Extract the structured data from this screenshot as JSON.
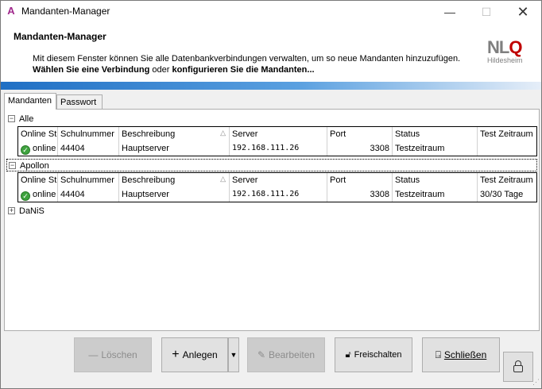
{
  "window": {
    "title": "Mandanten-Manager",
    "minimize": "—",
    "maximize": "☐",
    "close": "✕"
  },
  "header": {
    "title": "Mandanten-Manager",
    "description": "Mit diesem Fenster können Sie alle Datenbankverbindungen verwalten, um so neue Mandanten hinzuzufügen.",
    "select_prefix": "Wählen Sie eine Verbindung",
    "select_mid": "oder",
    "select_suffix": "konfigurieren Sie die Mandanten...",
    "logo_main": "NL",
    "logo_accent": "Q",
    "logo_sub": "Hildesheim"
  },
  "tabs": [
    {
      "label": "Mandanten",
      "active": true
    },
    {
      "label": "Passwort",
      "active": false
    }
  ],
  "columns": [
    "Online St",
    "Schulnummer",
    "Beschreibung",
    "Server",
    "Port",
    "Status",
    "Test Zeitraum"
  ],
  "groups": [
    {
      "name": "Alle",
      "expanded": true,
      "rows": [
        {
          "online": "online",
          "schulnummer": "44404",
          "beschreibung": "Hauptserver",
          "server": "192.168.111.26",
          "port": "3308",
          "status": "Testzeitraum",
          "test_zeitraum": ""
        }
      ]
    },
    {
      "name": "Apollon",
      "expanded": true,
      "rows": [
        {
          "online": "online",
          "schulnummer": "44404",
          "beschreibung": "Hauptserver",
          "server": "192.168.111.26",
          "port": "3308",
          "status": "Testzeitraum",
          "test_zeitraum": "30/30 Tage"
        }
      ]
    },
    {
      "name": "DaNiS",
      "expanded": false,
      "rows": []
    }
  ],
  "buttons": {
    "loeschen": "Löschen",
    "anlegen": "Anlegen",
    "bearbeiten": "Bearbeiten",
    "freischalten": "Freischalten",
    "schliessen": "Schließen"
  },
  "icons": {
    "online_ok": "check-circle-icon",
    "collapse": "⊟",
    "expand": "⊞"
  },
  "colors": {
    "accent": "#1f6fc4",
    "logo_red": "#c00000",
    "online_green": "#3fa33f"
  }
}
